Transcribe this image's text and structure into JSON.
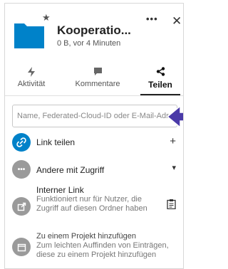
{
  "header": {
    "title": "Kooperatio...",
    "subtitle": "0 B, vor 4 Minuten"
  },
  "tabs": [
    {
      "label": "Aktivität",
      "icon": "activity-icon"
    },
    {
      "label": "Kommentare",
      "icon": "comment-icon"
    },
    {
      "label": "Teilen",
      "icon": "share-icon",
      "active": true
    }
  ],
  "search": {
    "placeholder": "Name, Federated-Cloud-ID oder E-Mail-Adresse"
  },
  "rows": {
    "link_share": {
      "label": "Link teilen",
      "action": "+"
    },
    "others_access": {
      "label": "Andere mit Zugriff",
      "action": "▾"
    },
    "internal_link": {
      "title": "Interner Link",
      "desc": "Funktioniert nur für Nutzer, die Zugriff auf diesen Ordner haben"
    },
    "project": {
      "title": "Zu einem Projekt hinzufügen",
      "desc": "Zum leichten Auffinden von Einträgen, diese zu einem Projekt hinzufügen"
    }
  },
  "colors": {
    "accent": "#0082c9",
    "folder": "#0082c9",
    "grey_avatar": "#9a9a9a",
    "pointer": "#4a3aa8"
  }
}
